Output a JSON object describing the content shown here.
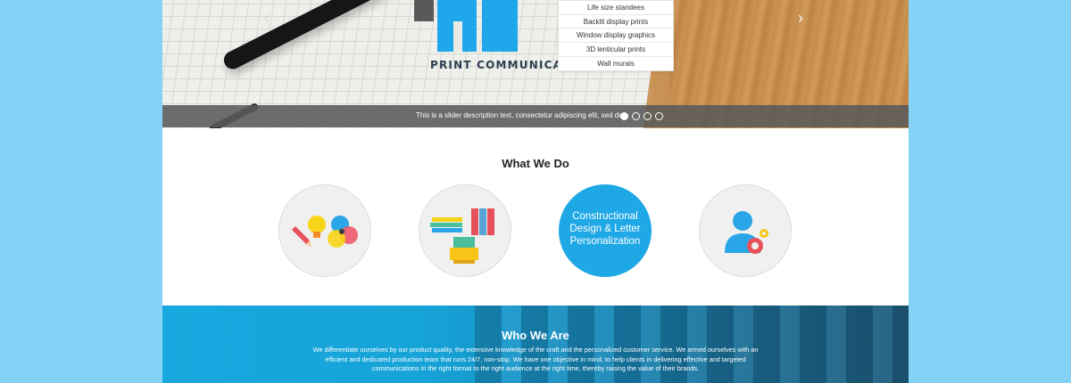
{
  "hero": {
    "company_name": "PRINT COMMUNICATIONS PTE LTD",
    "slider_text": "This is a slider description text, consectetur adipiscing elit, sed do",
    "prev_icon": "chevron-left-icon",
    "next_icon": "chevron-right-icon",
    "slide_count": 4,
    "active_slide": 1
  },
  "dropdown": {
    "items": [
      "Life size standees",
      "Backlit display prints",
      "Window display graphics",
      "3D lenticular prints",
      "Wall murals"
    ]
  },
  "what_we_do": {
    "title": "What We Do",
    "services": [
      {
        "icon": "design-palette-icon"
      },
      {
        "icon": "print-stack-icon"
      },
      {
        "label_lines": [
          "Constructional",
          "Design & Letter",
          "Personalization"
        ]
      },
      {
        "icon": "user-gear-icon"
      }
    ]
  },
  "who_we_are": {
    "title": "Who We Are",
    "text": "We differentiate ourselves by our product quality, the extensive knowledge of the craft and the personalized customer service. We armed ourselves with an efficient and dedicated production team that runs 24/7, non-stop. We have one objective in mind, to help clients in delivering effective and targeted communications in the right format to the right audience at the right time, thereby raising the value of their brands."
  },
  "colors": {
    "accent": "#1fa8e6",
    "background": "#84d2f6",
    "logo_gray": "#58595b"
  }
}
